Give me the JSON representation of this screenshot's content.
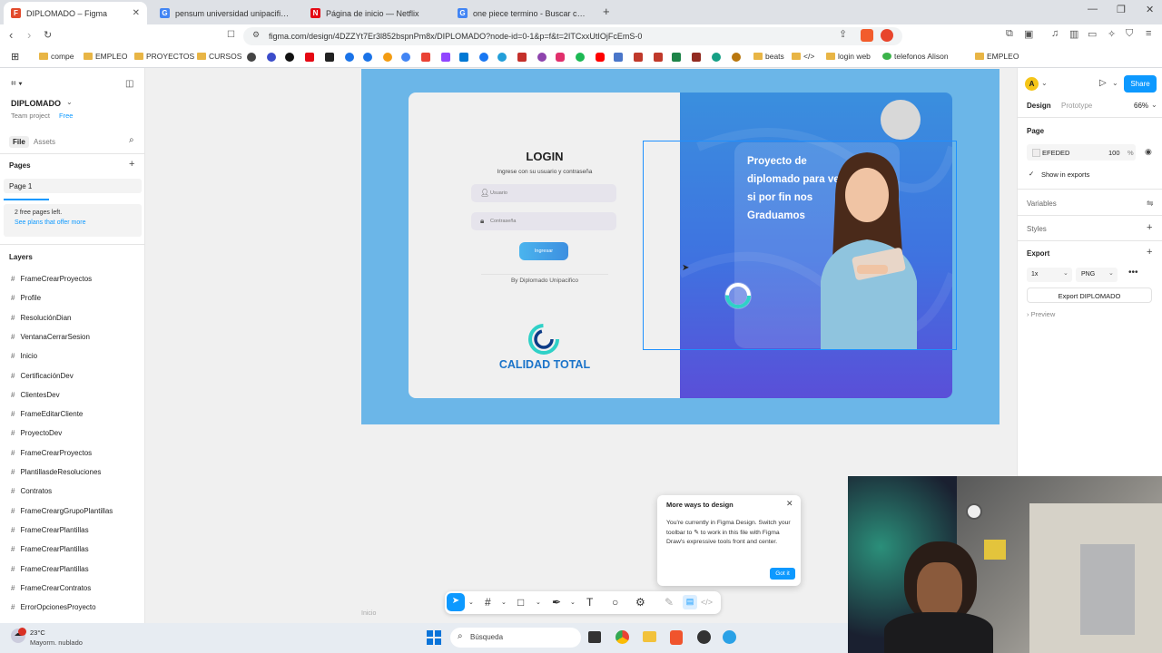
{
  "browser": {
    "tabs": [
      {
        "title": "DIPLOMADO – Figma",
        "favicon": "figma-icon",
        "color": "#e24b2d"
      },
      {
        "title": "pensum universidad unipacifico - Bu",
        "favicon": "google-icon",
        "color": "#4285f4"
      },
      {
        "title": "Página de inicio — Netflix",
        "favicon": "netflix-icon",
        "color": "#e50914"
      },
      {
        "title": "one piece termino - Buscar con Goo",
        "favicon": "google-icon",
        "color": "#4285f4"
      }
    ],
    "new_tab": "+",
    "url": "figma.com/design/4DZZYt7Er3l852bspnPm8x/DIPLOMADO?node-id=0-1&p=f&t=2ITCxxUtIOjFcEmS-0",
    "bookmarks": [
      "compe",
      "EMPLEO",
      "PROYECTOS",
      "CURSOS",
      "beats",
      "login web",
      "telefonos Alison",
      "EMPLEO"
    ]
  },
  "figma": {
    "file_name": "DIPLOMADO",
    "team": "Team project",
    "plan": "Free",
    "tab_file": "File",
    "tab_assets": "Assets",
    "pages_title": "Pages",
    "page_name": "Page 1",
    "pages_left": "2 free pages left.",
    "see_plans": "See plans that offer more",
    "layers_title": "Layers",
    "layers": [
      "FrameCrearProyectos",
      "Profile",
      "ResoluciónDian",
      "VentanaCerrarSesion",
      "Inicio",
      "CertificaciónDev",
      "ClientesDev",
      "FrameEditarCliente",
      "ProyectoDev",
      "FrameCrearProyectos",
      "PlantillasdeResoluciones",
      "Contratos",
      "FrameCreargGrupoPlantillas",
      "FrameCrearPlantillas",
      "FrameCrearPlantillas",
      "FrameCrearPlantillas",
      "FrameCrearContratos",
      "ErrorOpcionesProyecto"
    ],
    "right": {
      "avatar": "A",
      "share": "Share",
      "tab_design": "Design",
      "tab_prototype": "Prototype",
      "zoom": "66%",
      "page_label": "Page",
      "page_color": "EFEDED",
      "page_opacity": "100",
      "percent": "%",
      "show_exports": "Show in exports",
      "variables": "Variables",
      "styles": "Styles",
      "export": "Export",
      "scale": "1x",
      "format": "PNG",
      "export_button": "Export DIPLOMADO",
      "preview": "Preview"
    },
    "canvas_label": "Inicio",
    "design": {
      "login_title": "LOGIN",
      "subtitle": "Ingrese con su usuario y contraseña",
      "user_placeholder": "Usuario",
      "password_placeholder": "Contraseña",
      "button": "Ingresar",
      "by": "By Diplomado Unipacifico",
      "brand": "CALIDAD TOTAL",
      "hero_text": "Proyecto de diplomado para ver si por  fin nos Graduamos"
    },
    "popup": {
      "title": "More ways to design",
      "body": "You're currently in Figma Design. Switch your toolbar to ✎ to work in this file with Figma Draw's expressive tools front and center.",
      "button": "Got it"
    }
  },
  "taskbar": {
    "temp": "23°C",
    "weather": "Mayorm. nublado",
    "search": "Búsqueda"
  },
  "colors": {
    "frame_bg": "#6bb6e8",
    "brand_blue": "#1a73c9",
    "figma_blue": "#0d99ff"
  }
}
